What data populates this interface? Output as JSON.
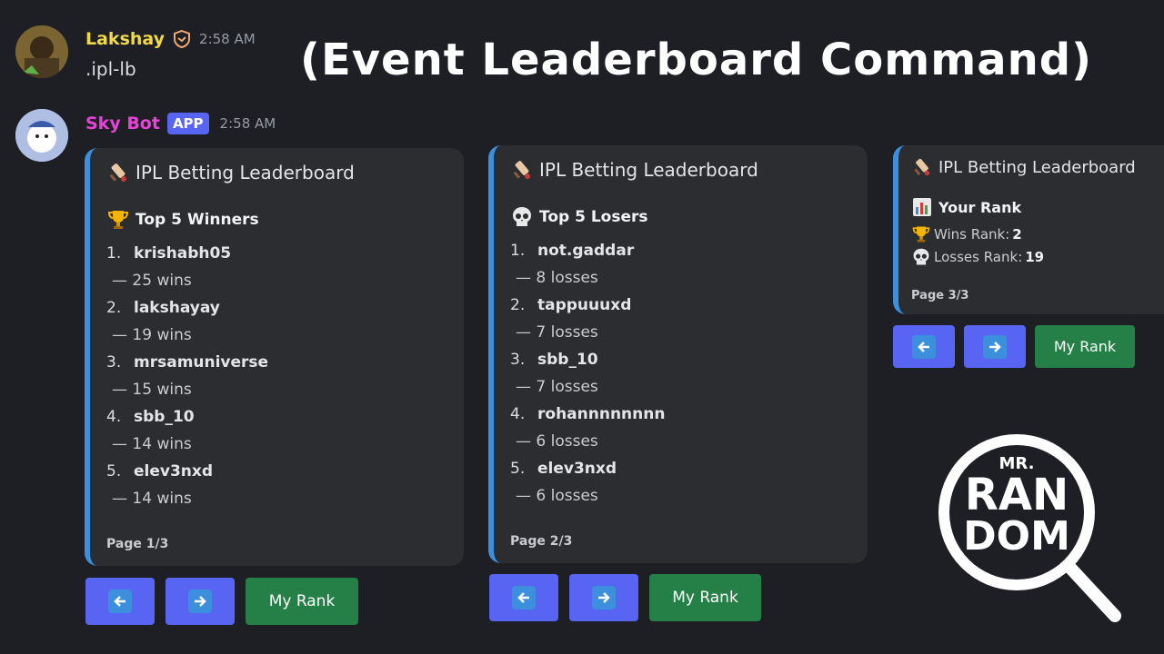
{
  "headline": "(Event Leaderboard Command)",
  "message1": {
    "username": "Lakshay",
    "time": "2:58 AM",
    "text": ".ipl-lb"
  },
  "message2": {
    "username": "Sky Bot",
    "badge": "APP",
    "time": "2:58 AM"
  },
  "embed1": {
    "title": "IPL Betting Leaderboard",
    "section": "Top 5 Winners",
    "entries": [
      {
        "rank": "1.",
        "name": "krishabh05",
        "value": "— 25 wins"
      },
      {
        "rank": "2.",
        "name": "lakshayay",
        "value": "— 19 wins"
      },
      {
        "rank": "3.",
        "name": "mrsamuniverse",
        "value": "— 15 wins"
      },
      {
        "rank": "4.",
        "name": "sbb_10",
        "value": "— 14 wins"
      },
      {
        "rank": "5.",
        "name": "elev3nxd",
        "value": "— 14 wins"
      }
    ],
    "footer": "Page 1/3"
  },
  "embed2": {
    "title": "IPL Betting Leaderboard",
    "section": "Top 5 Losers",
    "entries": [
      {
        "rank": "1.",
        "name": "not.gaddar",
        "value": "— 8 losses"
      },
      {
        "rank": "2.",
        "name": "tappuuuxd",
        "value": "— 7 losses"
      },
      {
        "rank": "3.",
        "name": "sbb_10",
        "value": "— 7 losses"
      },
      {
        "rank": "4.",
        "name": "rohannnnnnnn",
        "value": "— 6 losses"
      },
      {
        "rank": "5.",
        "name": "elev3nxd",
        "value": "— 6 losses"
      }
    ],
    "footer": "Page 2/3"
  },
  "embed3": {
    "title": "IPL Betting Leaderboard",
    "section": "Your Rank",
    "wins_label": "Wins Rank:",
    "wins_value": "2",
    "losses_label": "Losses Rank:",
    "losses_value": "19",
    "footer": "Page 3/3"
  },
  "buttons": {
    "my_rank": "My Rank"
  },
  "logo": {
    "text_top": "MR.",
    "text_mid": "RAN",
    "text_bot": "DOM"
  },
  "colors": {
    "background": "#1e1f25",
    "embed_bg": "#2b2d31",
    "embed_accent": "#3b8fdc",
    "blurple": "#5865f2",
    "green": "#248046",
    "lakshay_name": "#f0d848",
    "skybot_name": "#e843d8"
  },
  "icons": [
    "cricket-bat-icon",
    "trophy-icon",
    "skull-icon",
    "bar-chart-icon",
    "shield-icon",
    "arrow-left-icon",
    "arrow-right-icon",
    "magnifier-icon"
  ]
}
